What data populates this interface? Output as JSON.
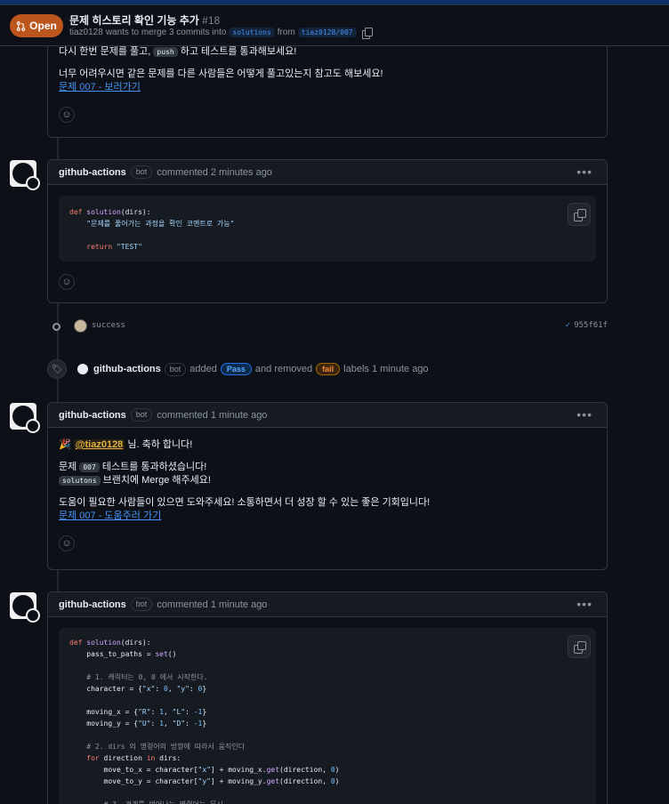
{
  "header": {
    "state": "Open",
    "title": "문제 히스토리 확인 기능 추가",
    "number": "#18",
    "author": "tiaz0128",
    "merge_text": "wants to merge 3 commits into",
    "base_branch": "solutions",
    "from_text": "from",
    "head_branch": "tiaz0128/007"
  },
  "first_comment": {
    "line1_pre": "다시 한번 문제를 풀고,",
    "line1_code": "push",
    "line1_post": "하고 테스트를 통과해보세요!",
    "line2": "너무 어려우시면 같은 문제를 다른 사람들은 어떻게 풀고있는지 참고도 해보세요!",
    "link": "문제 007 - 보러가기"
  },
  "comment2": {
    "author": "github-actions",
    "bot": "bot",
    "meta": "commented 2 minutes ago",
    "code": [
      [
        "def ",
        "solution",
        "(dirs):"
      ],
      [
        "    ",
        "\"문제를 풀어가는 과정을 확인 코멘트로 가능\""
      ],
      [
        ""
      ],
      [
        "    return ",
        "\"TEST\""
      ]
    ]
  },
  "commit": {
    "message": "success",
    "sha": "955f61f"
  },
  "label_event": {
    "actor": "github-actions",
    "bot": "bot",
    "added": "added",
    "pass_label": "Pass",
    "and_removed": "and removed",
    "fail_label": "fail",
    "suffix": "labels 1 minute ago"
  },
  "comment3": {
    "author": "github-actions",
    "bot": "bot",
    "meta": "commented 1 minute ago",
    "party": "🎉",
    "mention": "@tiaz0128",
    "greeting": "님. 축하 합니다!",
    "p2_pre": "문제",
    "p2_code": "007",
    "p2_post": "테스트를 통과하셨습니다!",
    "p3_code": "solutons",
    "p3_post": "브랜치에 Merge 해주세요!",
    "p4": "도움이 필요한 사람들이 있으면 도와주세요! 소통하면서 더 성장 할 수 있는 좋은 기회입니다!",
    "link": "문제 007 - 도움주러 가기"
  },
  "comment4": {
    "author": "github-actions",
    "bot": "bot",
    "meta": "commented 1 minute ago"
  }
}
